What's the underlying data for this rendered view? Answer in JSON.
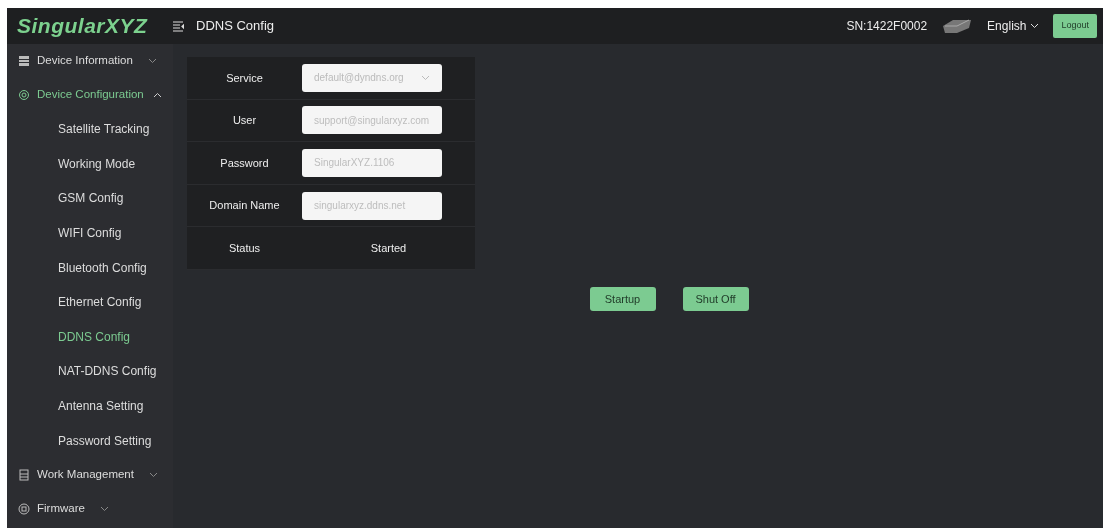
{
  "header": {
    "logo": "SingularXYZ",
    "page_title": "DDNS Config",
    "serial": "SN:1422F0002",
    "language": "English",
    "logout": "Logout"
  },
  "sidebar": {
    "items": [
      {
        "label": "Device Information",
        "expanded": false,
        "selected": false
      },
      {
        "label": "Device Configuration",
        "expanded": true,
        "selected": true,
        "children": [
          {
            "label": "Satellite Tracking",
            "selected": false
          },
          {
            "label": "Working Mode",
            "selected": false
          },
          {
            "label": "GSM Config",
            "selected": false
          },
          {
            "label": "WIFI Config",
            "selected": false
          },
          {
            "label": "Bluetooth Config",
            "selected": false
          },
          {
            "label": "Ethernet Config",
            "selected": false
          },
          {
            "label": "DDNS Config",
            "selected": true
          },
          {
            "label": "NAT-DDNS Config",
            "selected": false
          },
          {
            "label": "Antenna Setting",
            "selected": false
          },
          {
            "label": "Password Setting",
            "selected": false
          }
        ]
      },
      {
        "label": "Work Management",
        "expanded": false,
        "selected": false
      },
      {
        "label": "Firmware",
        "expanded": false,
        "selected": false
      }
    ]
  },
  "form": {
    "rows": [
      {
        "label": "Service",
        "kind": "select",
        "placeholder": "default@dyndns.org"
      },
      {
        "label": "User",
        "kind": "input",
        "placeholder": "support@singularxyz.com"
      },
      {
        "label": "Password",
        "kind": "input",
        "placeholder": "SingularXYZ.1106"
      },
      {
        "label": "Domain Name",
        "kind": "input",
        "placeholder": "singularxyz.ddns.net"
      },
      {
        "label": "Status",
        "kind": "text",
        "value": "Started"
      }
    ]
  },
  "buttons": [
    "Startup",
    "Shut Off"
  ]
}
